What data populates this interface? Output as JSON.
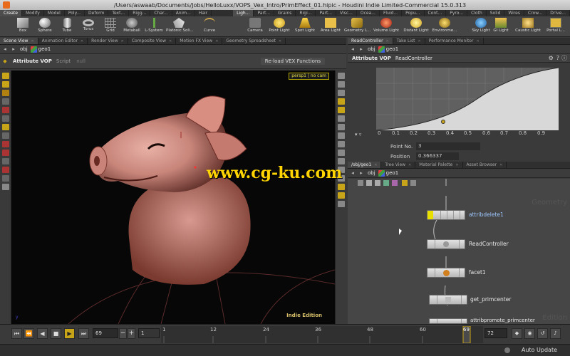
{
  "window": {
    "title": "/Users/aswaab/Documents/Jobs/HelloLuxx/VOPS_Vex_Intro/PrimEffect_01.hipic - Houdini Indie Limited-Commercial 15.0.313"
  },
  "shelf": {
    "tabs_left": [
      "Create",
      "Modify",
      "Model",
      "Poly...",
      "Deform",
      "Text...",
      "Rigg...",
      "Char...",
      "Anim...",
      "Hair"
    ],
    "tabs_right": [
      "Ligh...",
      "Part...",
      "Grains",
      "Rigi...",
      "Part...",
      "Visc...",
      "Ocea...",
      "Fluid...",
      "Popu...",
      "Cont...",
      "Pyro...",
      "Cloth",
      "Solid",
      "Wires",
      "Crow...",
      "Drive..."
    ],
    "tools_left": [
      "Box",
      "Sphere",
      "Tube",
      "Torus",
      "Grid",
      "Metaball",
      "L-System",
      "Platonic Soli...",
      "Curve"
    ],
    "tools_right": [
      "Camera",
      "Point Light",
      "Spot Light",
      "Area Light",
      "Geometry L...",
      "Volume Light",
      "Distant Light",
      "Environme...",
      "Sky Light",
      "GI Light",
      "Caustic Light",
      "Portal L..."
    ]
  },
  "left_pane": {
    "tabs": [
      "Scene View",
      "Animation Editor",
      "Render View",
      "Composite View",
      "Motion FX View",
      "Geometry Spreadsheet"
    ],
    "path": {
      "obj": "obj",
      "geo": "geo1"
    },
    "op_name": "Attribute VOP",
    "op_sub": "Script",
    "op_script_value": "null",
    "reload_button": "Re-load VEX Functions",
    "camera_label": "persp1",
    "camera_menu": "no cam",
    "edition": "Indie Edition",
    "axis_label": "y"
  },
  "right_top": {
    "tabs": [
      "ReadController",
      "Take List",
      "Performance Monitor"
    ],
    "path": {
      "obj": "obj",
      "geo": "geo1"
    },
    "op_name": "Attribute VOP",
    "op_node": "ReadController",
    "ramp_ticks": [
      "0",
      "0.1",
      "0.2",
      "0.3",
      "0.4",
      "0.5",
      "0.6",
      "0.7",
      "0.8",
      "0.9"
    ],
    "point_no_label": "Point No.",
    "point_no_value": "3",
    "position_label": "Position",
    "position_value": "0.366337"
  },
  "network": {
    "tabs": [
      "/obj/geo1",
      "Tree View",
      "Material Palette",
      "Asset Browser"
    ],
    "path": {
      "obj": "obj",
      "geo": "geo1"
    },
    "watermark_right": "Geometry",
    "nodes": [
      "attribdelete1",
      "ReadController",
      "facet1",
      "get_primcenter",
      "attribpromote_primcenter"
    ],
    "watermark_bottom": "Edition"
  },
  "timeline": {
    "current_frame": "69",
    "step": "1",
    "ruler_ticks": [
      "1",
      "12",
      "24",
      "36",
      "48",
      "60",
      "69"
    ],
    "end_frame_a": "72",
    "end_frame_b": "72"
  },
  "status": {
    "auto_update": "Auto Update"
  },
  "overlay": {
    "watermark": "www.cg-ku.com"
  },
  "colors": {
    "accent_yellow": "#c8a418",
    "viewport_bg": "#070707",
    "node_select": "#e8e000"
  }
}
